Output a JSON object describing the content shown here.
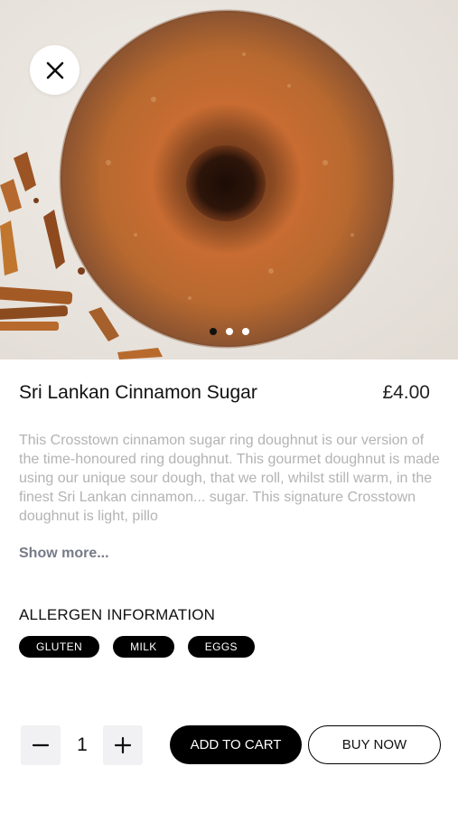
{
  "product": {
    "title": "Sri Lankan Cinnamon Sugar",
    "price": "£4.00",
    "description": "This Crosstown cinnamon sugar ring doughnut is our version of the time-honoured ring doughnut. This gourmet doughnut is made using our unique sour dough, that we roll, whilst still warm, in the finest Sri Lankan cinnamon... sugar. This signature Crosstown doughnut is light, pillo",
    "show_more_label": "Show more..."
  },
  "gallery": {
    "image": "cinnamon-sugar-doughnut",
    "slide_count": 3,
    "active_slide": 1
  },
  "allergens": {
    "heading": "ALLERGEN INFORMATION",
    "items": [
      "GLUTEN",
      "MILK",
      "EGGS"
    ]
  },
  "cart": {
    "quantity": "1",
    "add_to_cart_label": "ADD TO CART",
    "buy_now_label": "BUY NOW"
  },
  "icons": {
    "close": "close-icon",
    "minus": "minus-icon",
    "plus": "plus-icon"
  },
  "colors": {
    "primary": "#000000",
    "description_text": "#b3b3b3",
    "link_text": "#777a87",
    "stepper_bg": "#f1f1f3"
  }
}
